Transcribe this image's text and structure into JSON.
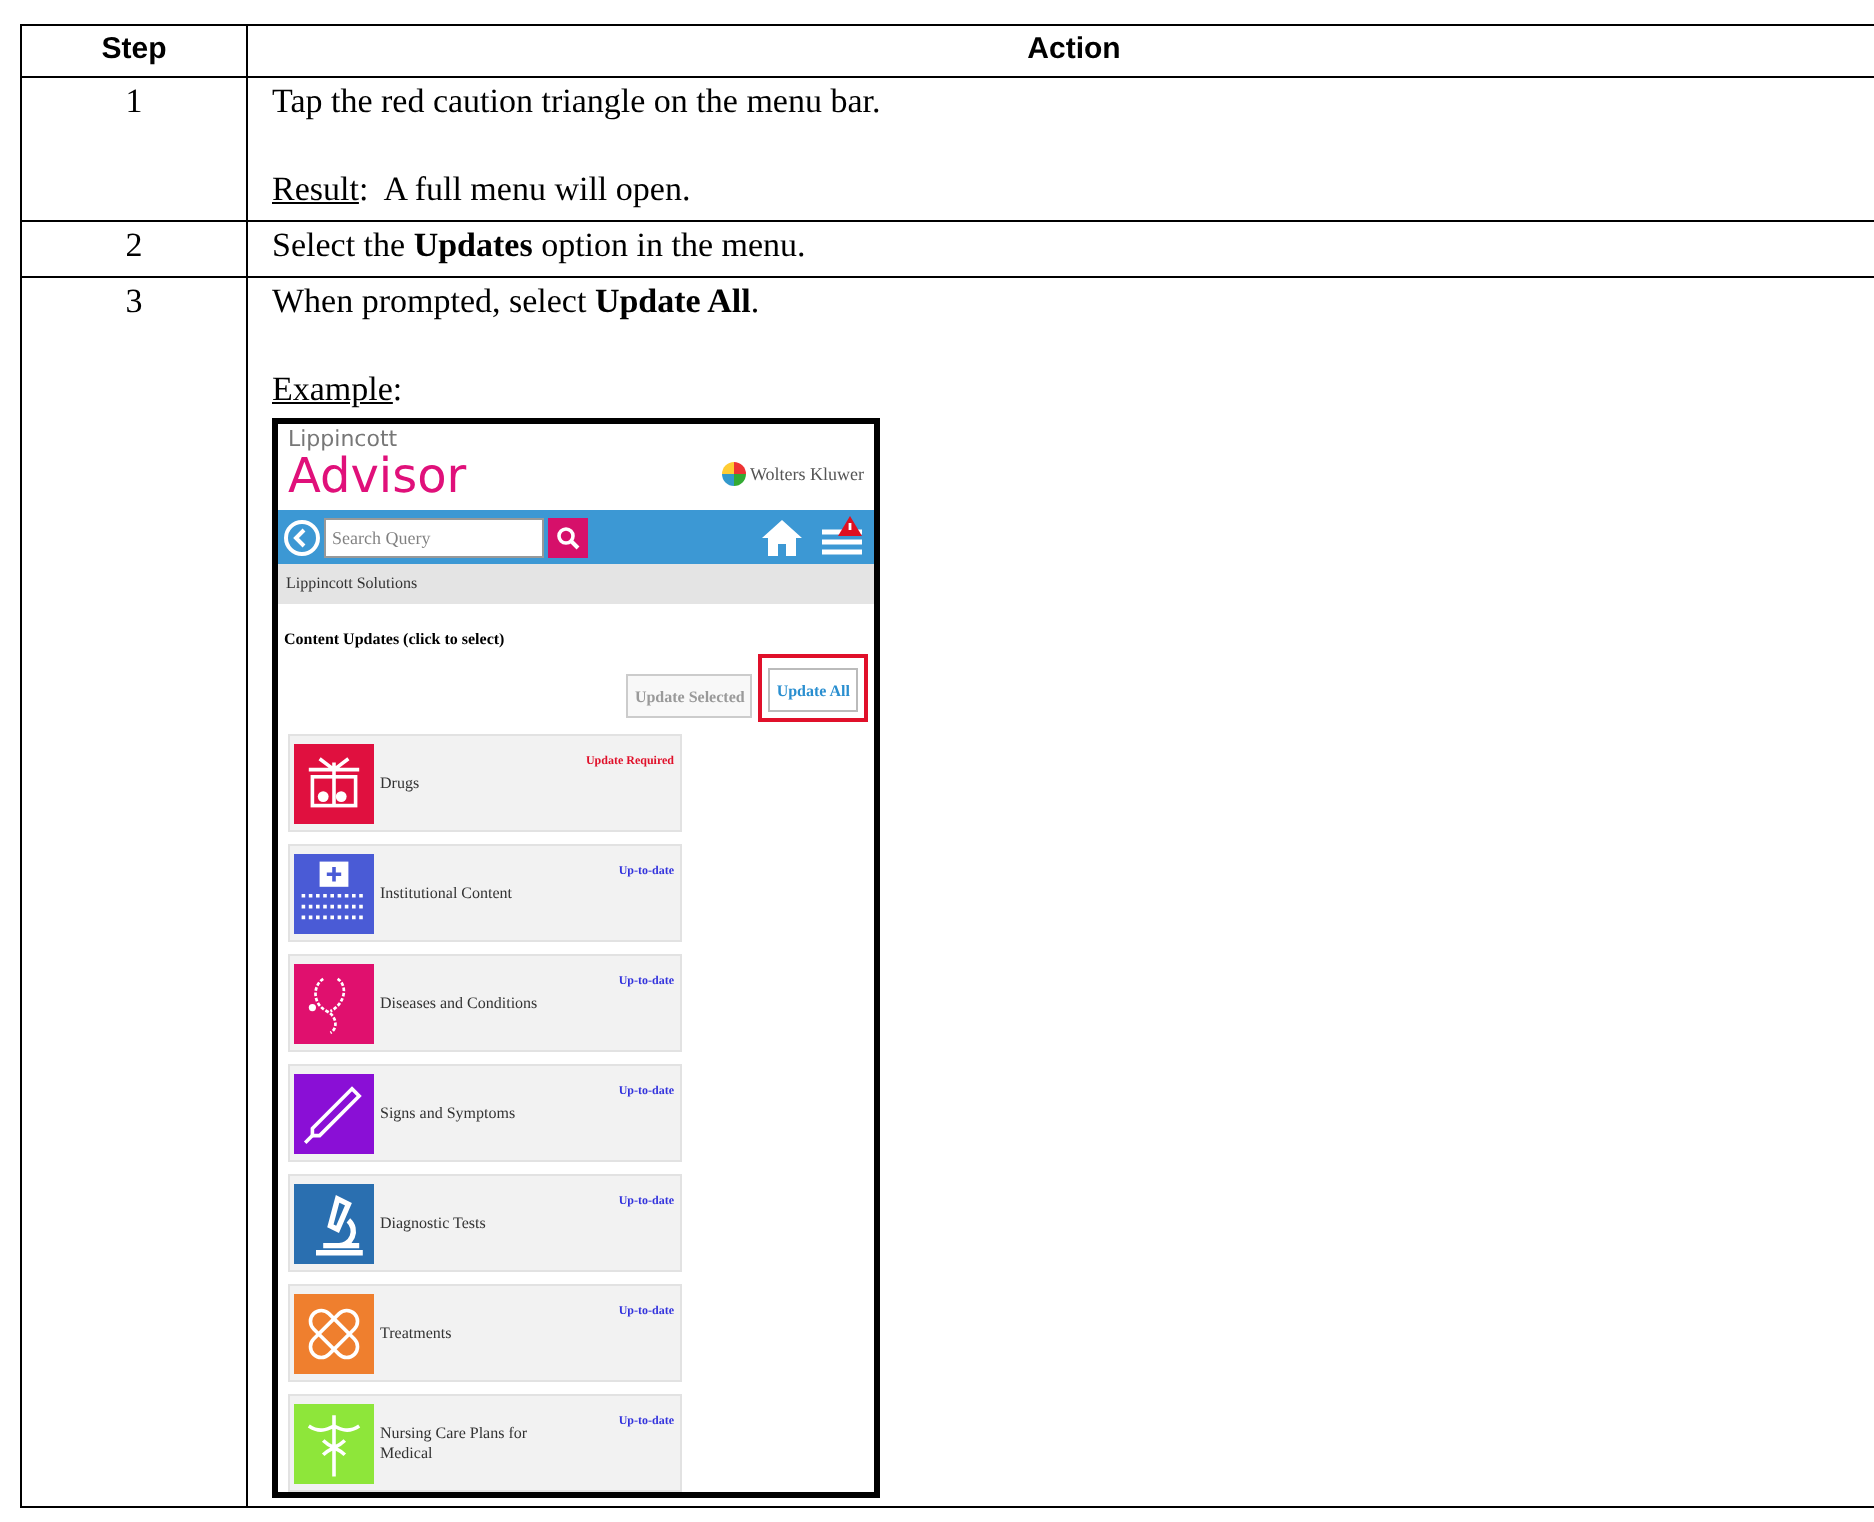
{
  "table": {
    "columns": [
      "Step",
      "Action"
    ],
    "rows": [
      {
        "step": "1",
        "lines": [
          {
            "kind": "text",
            "text": "Tap the red caution triangle on the menu bar."
          },
          {
            "kind": "result",
            "label": "Result",
            "text": ":  A full menu will open."
          }
        ]
      },
      {
        "step": "2",
        "lines": [
          {
            "kind": "text",
            "text": "Select the **Updates** option in the menu."
          }
        ]
      },
      {
        "step": "3",
        "lines": [
          {
            "kind": "text",
            "text": "When prompted, select **Update All**."
          },
          {
            "kind": "example",
            "label": "Example",
            "text": ":"
          }
        ]
      }
    ]
  },
  "app": {
    "brand_small": "Lippincott",
    "brand_large": "Advisor",
    "partner": "Wolters Kluwer",
    "search": {
      "placeholder": "Search Query"
    },
    "alert": true,
    "breadcrumb": "Lippincott Solutions",
    "section_title": "Content Updates (click to select)",
    "buttons": [
      {
        "label": "Update Selected",
        "disabled": true,
        "highlighted": false
      },
      {
        "label": "Update All",
        "disabled": false,
        "highlighted": true
      }
    ],
    "categories": [
      {
        "name": "Drugs",
        "status": "Update Required",
        "kind": "required",
        "color": "#e0103f"
      },
      {
        "name": "Institutional Content",
        "status": "Up-to-date",
        "kind": "current",
        "color": "#4a5bd6"
      },
      {
        "name": "Diseases and Conditions",
        "status": "Up-to-date",
        "kind": "current",
        "color": "#e0106e"
      },
      {
        "name": "Signs and Symptoms",
        "status": "Up-to-date",
        "kind": "current",
        "color": "#8a0fd6"
      },
      {
        "name": "Diagnostic Tests",
        "status": "Up-to-date",
        "kind": "current",
        "color": "#2a6fb0"
      },
      {
        "name": "Treatments",
        "status": "Up-to-date",
        "kind": "current",
        "color": "#ef7f2e"
      },
      {
        "name": "Nursing Care Plans for Medical",
        "status": "Up-to-date",
        "kind": "current",
        "color": "#8ee63a"
      }
    ]
  }
}
